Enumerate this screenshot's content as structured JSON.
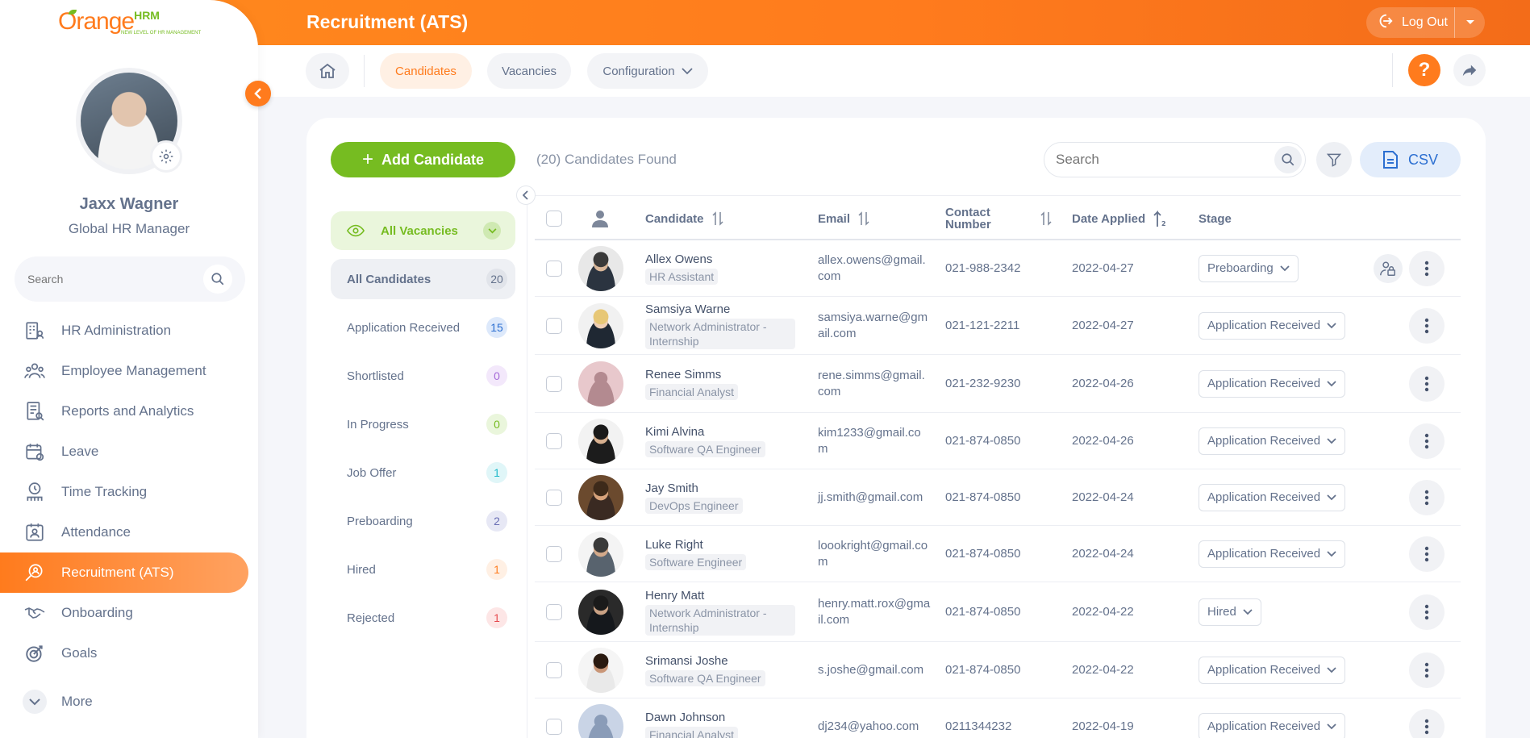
{
  "brand": {
    "logo_main": "Orange",
    "logo_suffix": "HRM",
    "logo_tagline": "NEW LEVEL OF HR MANAGEMENT"
  },
  "header": {
    "title": "Recruitment (ATS)",
    "logout_label": "Log Out"
  },
  "user": {
    "name": "Jaxx Wagner",
    "role": "Global HR Manager"
  },
  "sidebar": {
    "search_placeholder": "Search",
    "items": [
      {
        "label": "HR Administration",
        "icon": "hr-admin-icon"
      },
      {
        "label": "Employee Management",
        "icon": "employee-icon"
      },
      {
        "label": "Reports and Analytics",
        "icon": "reports-icon"
      },
      {
        "label": "Leave",
        "icon": "leave-icon"
      },
      {
        "label": "Time Tracking",
        "icon": "time-icon"
      },
      {
        "label": "Attendance",
        "icon": "attendance-icon"
      },
      {
        "label": "Recruitment (ATS)",
        "icon": "recruitment-icon",
        "active": true
      },
      {
        "label": "Onboarding",
        "icon": "onboarding-icon"
      },
      {
        "label": "Goals",
        "icon": "goals-icon"
      }
    ],
    "more_label": "More"
  },
  "subnav": {
    "tabs": [
      {
        "label": "Candidates",
        "active": true
      },
      {
        "label": "Vacancies"
      },
      {
        "label": "Configuration"
      }
    ],
    "help_label": "?"
  },
  "toolbar": {
    "add_label": "Add Candidate",
    "found_text": "(20) Candidates Found",
    "search_placeholder": "Search",
    "csv_label": "CSV"
  },
  "filters": {
    "vacancies_label": "All Vacancies",
    "stages": [
      {
        "label": "All Candidates",
        "count": "20",
        "color": "#64728c",
        "bg": "#e1e4ea"
      },
      {
        "label": "Application Received",
        "count": "15",
        "color": "#2c6fd1",
        "bg": "#dde9fb"
      },
      {
        "label": "Shortlisted",
        "count": "0",
        "color": "#a66bd8",
        "bg": "#f3e8fb"
      },
      {
        "label": "In Progress",
        "count": "0",
        "color": "#76bc21",
        "bg": "#eaf6dc"
      },
      {
        "label": "Job Offer",
        "count": "1",
        "color": "#1cb8c9",
        "bg": "#e0f6f8"
      },
      {
        "label": "Preboarding",
        "count": "2",
        "color": "#6a6fb5",
        "bg": "#e7e8f5"
      },
      {
        "label": "Hired",
        "count": "1",
        "color": "#ff7b1d",
        "bg": "#fff0e4"
      },
      {
        "label": "Rejected",
        "count": "1",
        "color": "#e5484d",
        "bg": "#fde6e6"
      }
    ]
  },
  "table": {
    "headers": {
      "candidate": "Candidate",
      "email": "Email",
      "contact": "Contact Number",
      "date": "Date Applied",
      "stage": "Stage"
    },
    "rows": [
      {
        "name": "Allex Owens",
        "role": "HR Assistant",
        "email": "allex.owens@gmail.com",
        "contact": "021-988-2342",
        "date": "2022-04-27",
        "stage": "Preboarding",
        "photo": "man-suit-a",
        "extra_action": true
      },
      {
        "name": "Samsiya Warne",
        "role": "Network Administrator - Internship",
        "email": "samsiya.warne@gmail.com",
        "contact": "021-121-2211",
        "date": "2022-04-27",
        "stage": "Application Received",
        "photo": "woman-blonde"
      },
      {
        "name": "Renee Simms",
        "role": "Financial Analyst",
        "email": "rene.simms@gmail.com",
        "contact": "021-232-9230",
        "date": "2022-04-26",
        "stage": "Application Received",
        "photo": "placeholder-pink"
      },
      {
        "name": "Kimi Alvina",
        "role": "Software QA Engineer",
        "email": "kim1233@gmail.com",
        "contact": "021-874-0850",
        "date": "2022-04-26",
        "stage": "Application Received",
        "photo": "woman-dark"
      },
      {
        "name": "Jay Smith",
        "role": "DevOps Engineer",
        "email": "jj.smith@gmail.com",
        "contact": "021-874-0850",
        "date": "2022-04-24",
        "stage": "Application Received",
        "photo": "man-beard"
      },
      {
        "name": "Luke Right",
        "role": "Software Engineer",
        "email": "loookright@gmail.com",
        "contact": "021-874-0850",
        "date": "2022-04-24",
        "stage": "Application Received",
        "photo": "man-standing"
      },
      {
        "name": "Henry Matt",
        "role": "Network Administrator - Internship",
        "email": "henry.matt.rox@gmail.com",
        "contact": "021-874-0850",
        "date": "2022-04-22",
        "stage": "Hired",
        "photo": "man-dark"
      },
      {
        "name": "Srimansi Joshe",
        "role": "Software QA Engineer",
        "email": "s.joshe@gmail.com",
        "contact": "021-874-0850",
        "date": "2022-04-22",
        "stage": "Application Received",
        "photo": "woman-white"
      },
      {
        "name": "Dawn Johnson",
        "role": "Financial Analyst",
        "email": "dj234@yahoo.com",
        "contact": "0211344232",
        "date": "2022-04-19",
        "stage": "Application Received",
        "photo": "placeholder-blue"
      }
    ]
  },
  "colors": {
    "accent": "#ff7b1d",
    "green": "#76bc21",
    "text": "#64728c",
    "blue": "#2c6fd1"
  }
}
